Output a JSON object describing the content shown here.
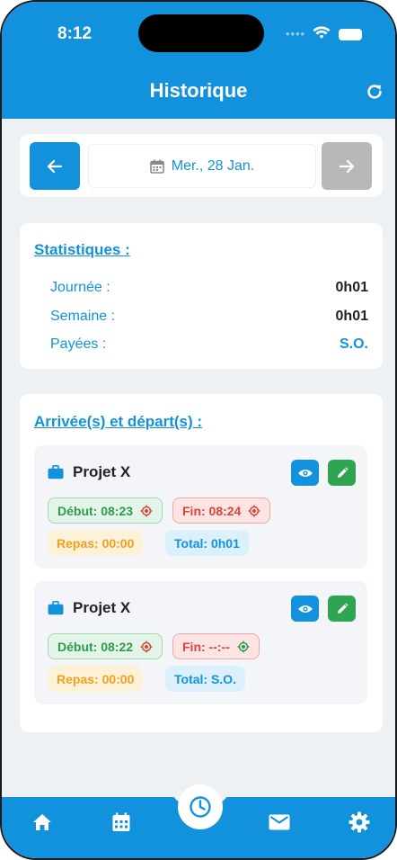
{
  "status": {
    "time": "8:12"
  },
  "header": {
    "title": "Historique"
  },
  "date_nav": {
    "date_label": "Mer., 28 Jan."
  },
  "stats": {
    "title": "Statistiques :",
    "rows": [
      {
        "label": "Journée :",
        "value": "0h01"
      },
      {
        "label": "Semaine :",
        "value": "0h01"
      },
      {
        "label": "Payées :",
        "value": "S.O."
      }
    ]
  },
  "entries_section": {
    "title": "Arrivée(s) et départ(s) :",
    "entries": [
      {
        "project": "Projet X",
        "start": "Début: 08:23",
        "end": "Fin: 08:24",
        "meal": "Repas: 00:00",
        "total": "Total: 0h01"
      },
      {
        "project": "Projet X",
        "start": "Début: 08:22",
        "end": "Fin: --:--",
        "meal": "Repas: 00:00",
        "total": "Total: S.O."
      }
    ]
  },
  "tabbar": {
    "items": [
      "home-icon",
      "calendar-icon",
      "clock-icon",
      "mail-icon",
      "gear-icon"
    ],
    "active": "clock-icon"
  },
  "colors": {
    "primary": "#1292dc",
    "success": "#2fa552",
    "danger": "#d9453a",
    "warning": "#f0a020",
    "disabled": "#b8b8b8"
  }
}
